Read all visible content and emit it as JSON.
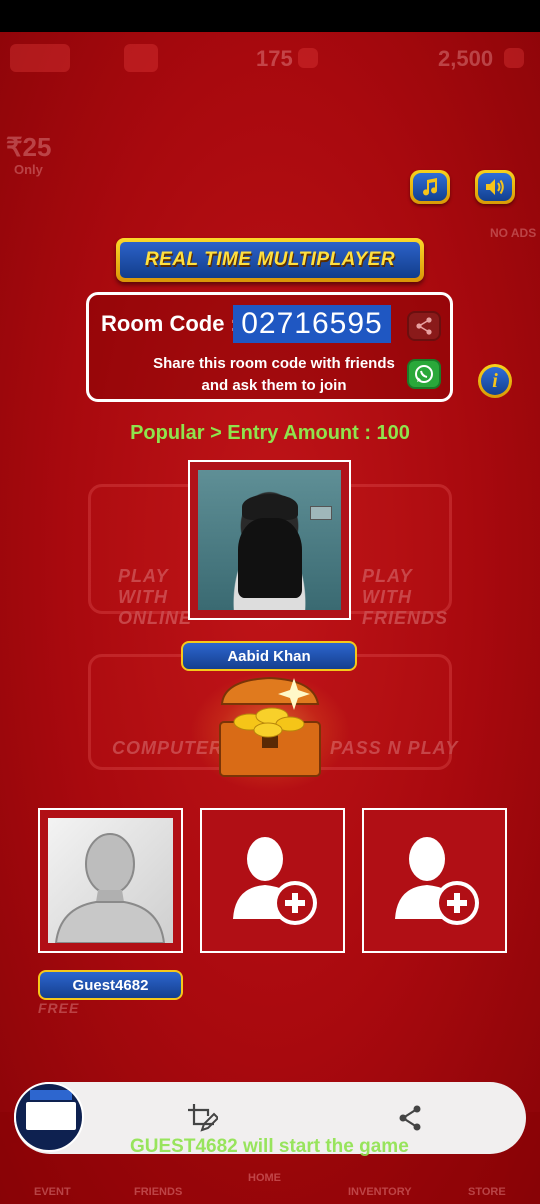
{
  "header": {
    "coins": "175",
    "gems": "2,500"
  },
  "background": {
    "price_tag": "₹25",
    "price_sub": "Only",
    "play_online": "PLAY WITH ONLINE",
    "play_friends": "PLAY WITH FRIENDS",
    "computer": "COMPUTER",
    "pass_n_play": "PASS N PLAY",
    "free": "FREE",
    "no_ads": "NO ADS",
    "nav": [
      "EVENT",
      "FRIENDS",
      "HOME",
      "INVENTORY",
      "STORE"
    ]
  },
  "banner": {
    "title": "REAL TIME MULTIPLAYER"
  },
  "room": {
    "label": "Room Code :",
    "code": "02716595",
    "message_line1": "Share this room code with friends",
    "message_line2": "and ask them to join"
  },
  "entry": {
    "text": "Popular > Entry Amount : 100"
  },
  "players": {
    "host_name": "Aabid Khan",
    "guest_name": "Guest4682"
  },
  "footer": {
    "start_message": "GUEST4682  will start the game"
  },
  "colors": {
    "background": "#a8090e",
    "accent_blue": "#1f57c2",
    "gold": "#f6c81a",
    "green_text": "#8fe34d"
  },
  "icons": {
    "music": "music-note-icon",
    "sound": "speaker-icon",
    "share": "share-icon",
    "whatsapp": "whatsapp-icon",
    "info": "info-icon",
    "add_player": "add-user-icon",
    "edit_screenshot": "crop-edit-icon"
  }
}
